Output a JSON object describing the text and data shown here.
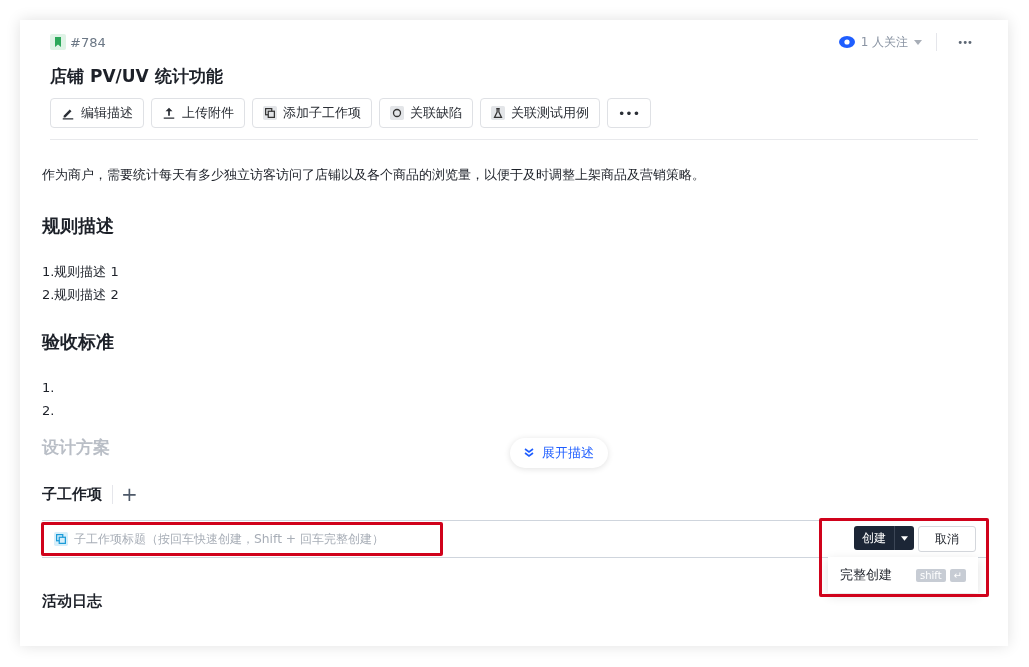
{
  "issue": {
    "id": "#784",
    "title": "店铺 PV/UV 统计功能"
  },
  "watchers": {
    "label": "1 人关注"
  },
  "more_button": "•••",
  "toolbar": [
    {
      "label": "编辑描述",
      "kind": "action"
    },
    {
      "label": "上传附件",
      "kind": "action"
    },
    {
      "label": "添加子工作项",
      "kind": "action"
    },
    {
      "label": "关联缺陷",
      "kind": "action"
    },
    {
      "label": "关联测试用例",
      "kind": "action"
    },
    {
      "label": "•••",
      "kind": "more"
    }
  ],
  "description": [
    {
      "kind": "paragraph",
      "text": "作为商户，需要统计每天有多少独立访客访问了店铺以及各个商品的浏览量，以便于及时调整上架商品及营销策略。"
    },
    {
      "kind": "heading",
      "text": "规则描述"
    },
    {
      "kind": "list",
      "items": [
        "1.规则描述 1",
        "2.规则描述 2"
      ]
    },
    {
      "kind": "heading",
      "text": "验收标准"
    },
    {
      "kind": "list",
      "items": [
        "1.",
        "2."
      ]
    },
    {
      "kind": "faded",
      "text": "设计方案"
    }
  ],
  "expand_button": "展开描述",
  "subitems": {
    "title": "子工作项",
    "add": "+",
    "placeholder": "子工作项标题（按回车快速创建，Shift + 回车完整创建）",
    "create_button": "创建",
    "cancel_button": "取消",
    "menu": [
      {
        "label": "完整创建",
        "keys": [
          "shift",
          "↵"
        ]
      }
    ]
  },
  "activity": {
    "title": "活动日志"
  }
}
